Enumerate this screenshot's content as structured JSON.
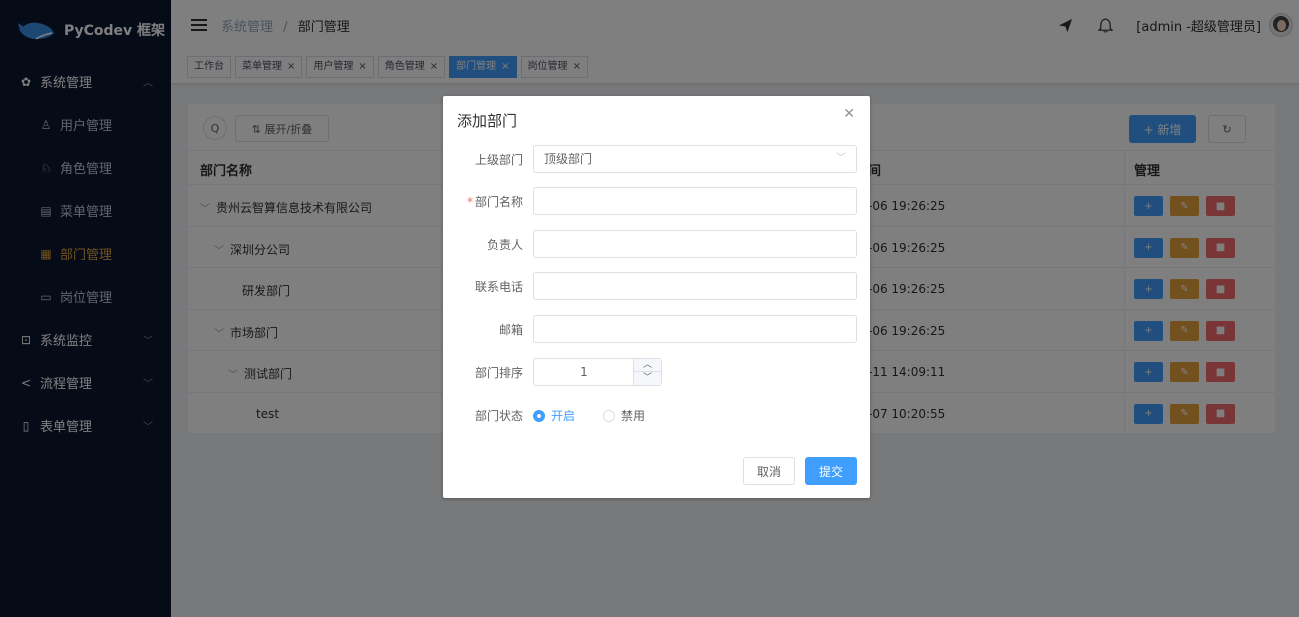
{
  "app": {
    "brand": "PyCodev 框架"
  },
  "sidebar": {
    "items": [
      {
        "label": "系统管理",
        "icon": "gear-icon",
        "level": "top",
        "arrow": "^"
      },
      {
        "label": "用户管理",
        "icon": "user-icon",
        "level": "sub"
      },
      {
        "label": "角色管理",
        "icon": "role-icon",
        "level": "sub"
      },
      {
        "label": "菜单管理",
        "icon": "menu-icon",
        "level": "sub"
      },
      {
        "label": "部门管理",
        "icon": "dept-icon",
        "level": "sub",
        "active": true
      },
      {
        "label": "岗位管理",
        "icon": "post-icon",
        "level": "sub"
      },
      {
        "label": "系统监控",
        "icon": "monitor-icon",
        "level": "top",
        "arrow": "v"
      },
      {
        "label": "流程管理",
        "icon": "share-icon",
        "level": "top",
        "arrow": "v"
      },
      {
        "label": "表单管理",
        "icon": "form-icon",
        "level": "top",
        "arrow": "v"
      }
    ]
  },
  "header": {
    "breadcrumb": {
      "parent": "系统管理",
      "separator": "/",
      "current": "部门管理"
    },
    "user": "[admin -超级管理员]"
  },
  "tabs": [
    {
      "label": "工作台",
      "closable": false
    },
    {
      "label": "菜单管理",
      "closable": true
    },
    {
      "label": "用户管理",
      "closable": true
    },
    {
      "label": "角色管理",
      "closable": true
    },
    {
      "label": "部门管理",
      "closable": true,
      "active": true
    },
    {
      "label": "岗位管理",
      "closable": true
    }
  ],
  "toolbar": {
    "expand_label": "⇅ 展开/折叠",
    "add_label": "+ 新增"
  },
  "table": {
    "headers": {
      "name": "部门名称",
      "time": "间",
      "ops": "管理"
    },
    "rows": [
      {
        "name": "贵州云智算信息技术有限公司",
        "indent": 0,
        "expandable": true,
        "time": "-06 19:26:25"
      },
      {
        "name": "深圳分公司",
        "indent": 1,
        "expandable": true,
        "time": "-06 19:26:25"
      },
      {
        "name": "研发部门",
        "indent": 2,
        "expandable": false,
        "time": "-06 19:26:25"
      },
      {
        "name": "市场部门",
        "indent": 1,
        "expandable": true,
        "time": "-06 19:26:25"
      },
      {
        "name": "测试部门",
        "indent": 2,
        "expandable": true,
        "time": "-11 14:09:11"
      },
      {
        "name": "test",
        "indent": 3,
        "expandable": false,
        "time": "-07 10:20:55"
      }
    ]
  },
  "dialog": {
    "title": "添加部门",
    "fields": {
      "parent": {
        "label": "上级部门",
        "value": "顶级部门"
      },
      "name": {
        "label": "部门名称",
        "required": "*",
        "value": ""
      },
      "leader": {
        "label": "负责人",
        "value": ""
      },
      "phone": {
        "label": "联系电话",
        "value": ""
      },
      "email": {
        "label": "邮箱",
        "value": ""
      },
      "sort": {
        "label": "部门排序",
        "value": "1"
      },
      "status": {
        "label": "部门状态",
        "options": [
          "开启",
          "禁用"
        ],
        "selected": "开启"
      }
    },
    "cancel_label": "取消",
    "submit_label": "提交"
  },
  "colors": {
    "primary": "#409eff",
    "warning": "#e6a23c",
    "danger": "#f56c6c",
    "sidebar_bg": "#0c1730"
  }
}
